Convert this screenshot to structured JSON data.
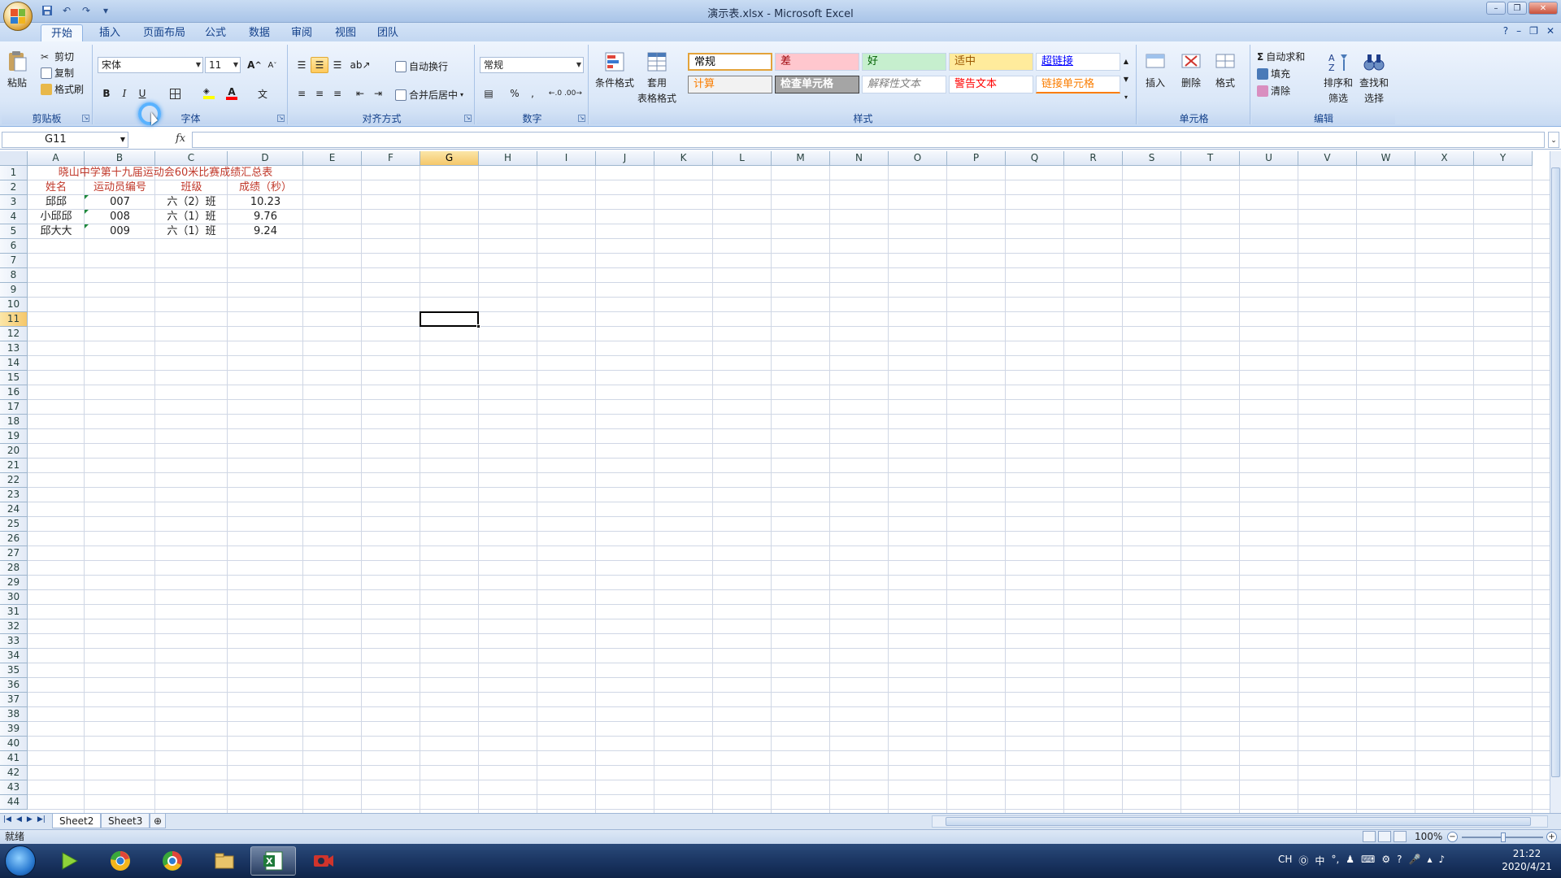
{
  "window": {
    "title": "演示表.xlsx - Microsoft Excel"
  },
  "ribbon_tabs": [
    "开始",
    "插入",
    "页面布局",
    "公式",
    "数据",
    "审阅",
    "视图",
    "团队"
  ],
  "active_tab": "开始",
  "clipboard": {
    "paste": "粘贴",
    "cut": "剪切",
    "copy": "复制",
    "format_painter": "格式刷",
    "label": "剪贴板"
  },
  "font": {
    "name": "宋体",
    "size": "11",
    "label": "字体",
    "grow": "A",
    "shrink": "A",
    "bold": "B",
    "italic": "I",
    "underline": "U"
  },
  "alignment": {
    "wrap_text": "自动换行",
    "merge_center": "合并后居中",
    "label": "对齐方式"
  },
  "number": {
    "format": "常规",
    "percent": "%",
    "comma": ",",
    "label": "数字"
  },
  "styles": {
    "conditional": "条件格式",
    "table_format_1": "套用",
    "table_format_2": "表格格式",
    "label": "样式",
    "gallery": [
      {
        "text": "常规",
        "bg": "#ffffff",
        "color": "#000000",
        "border": "#e3a33a"
      },
      {
        "text": "差",
        "bg": "#ffc7ce",
        "color": "#9c0006",
        "border": "#c6d5ea"
      },
      {
        "text": "好",
        "bg": "#c6efce",
        "color": "#006100",
        "border": "#c6d5ea"
      },
      {
        "text": "适中",
        "bg": "#ffeb9c",
        "color": "#9c5700",
        "border": "#c6d5ea"
      },
      {
        "text": "超链接",
        "bg": "#ffffff",
        "color": "#0000ff",
        "border": "#c6d5ea"
      },
      {
        "text": "计算",
        "bg": "#f2f2f2",
        "color": "#fa7d00",
        "border": "#7f7f7f"
      },
      {
        "text": "检查单元格",
        "bg": "#a5a5a5",
        "color": "#ffffff",
        "border": "#3f3f3f"
      },
      {
        "text": "解释性文本",
        "bg": "#ffffff",
        "color": "#7f7f7f",
        "border": "#c6d5ea"
      },
      {
        "text": "警告文本",
        "bg": "#ffffff",
        "color": "#ff0000",
        "border": "#c6d5ea"
      },
      {
        "text": "链接单元格",
        "bg": "#ffffff",
        "color": "#fa7d00",
        "border": "#c6d5ea"
      }
    ]
  },
  "cells_group": {
    "insert": "插入",
    "delete": "删除",
    "format": "格式",
    "label": "单元格"
  },
  "editing": {
    "autosum": "自动求和",
    "fill": "填充",
    "clear": "清除",
    "sort_filter_1": "排序和",
    "sort_filter_2": "筛选",
    "find_select_1": "查找和",
    "find_select_2": "选择",
    "label": "编辑"
  },
  "formula_bar": {
    "name_box": "G11",
    "fx": "fx",
    "formula": ""
  },
  "columns": [
    "A",
    "B",
    "C",
    "D",
    "E",
    "F",
    "G",
    "H",
    "I",
    "J",
    "K",
    "L",
    "M",
    "N",
    "O",
    "P",
    "Q",
    "R",
    "S",
    "T",
    "U",
    "V",
    "W",
    "X",
    "Y"
  ],
  "selected_column": "G",
  "selected_row": "11",
  "row_count": 44,
  "sheet": {
    "title": "晓山中学第十九届运动会60米比赛成绩汇总表",
    "headers": [
      "姓名",
      "运动员编号",
      "班级",
      "成绩（秒）"
    ],
    "rows": [
      [
        "邱邱",
        "007",
        "六（2）班",
        "10.23"
      ],
      [
        "小邱邱",
        "008",
        "六（1）班",
        "9.76"
      ],
      [
        "邱大大",
        "009",
        "六（1）班",
        "9.24"
      ]
    ]
  },
  "sheet_tabs": [
    "Sheet2",
    "Sheet3"
  ],
  "status": {
    "ready": "就绪",
    "zoom": "100%"
  },
  "taskbar": {
    "time": "21:22",
    "date": "2020/4/21",
    "lang": "CH",
    "ime": "中"
  }
}
